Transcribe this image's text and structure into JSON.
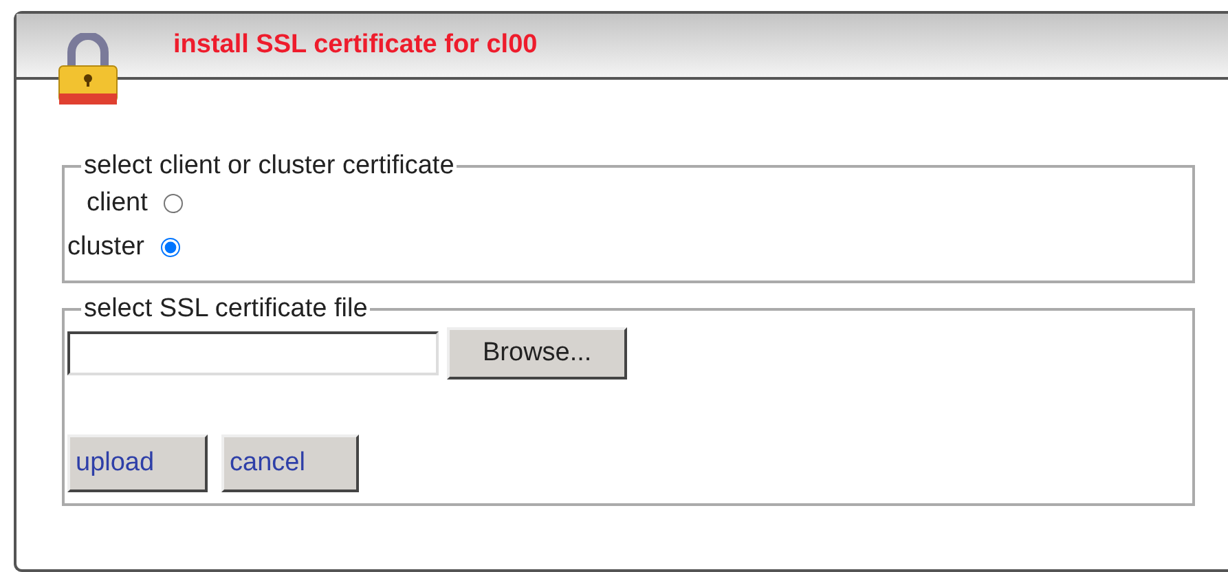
{
  "dialog": {
    "title": "install SSL certificate for cl00"
  },
  "certificate_type": {
    "legend": "select client or cluster certificate",
    "options": [
      {
        "label": "client",
        "selected": false
      },
      {
        "label": "cluster",
        "selected": true
      }
    ]
  },
  "file": {
    "legend": "select SSL certificate file",
    "browse_button": "Browse..."
  },
  "buttons": [
    "upload",
    "cancel"
  ]
}
